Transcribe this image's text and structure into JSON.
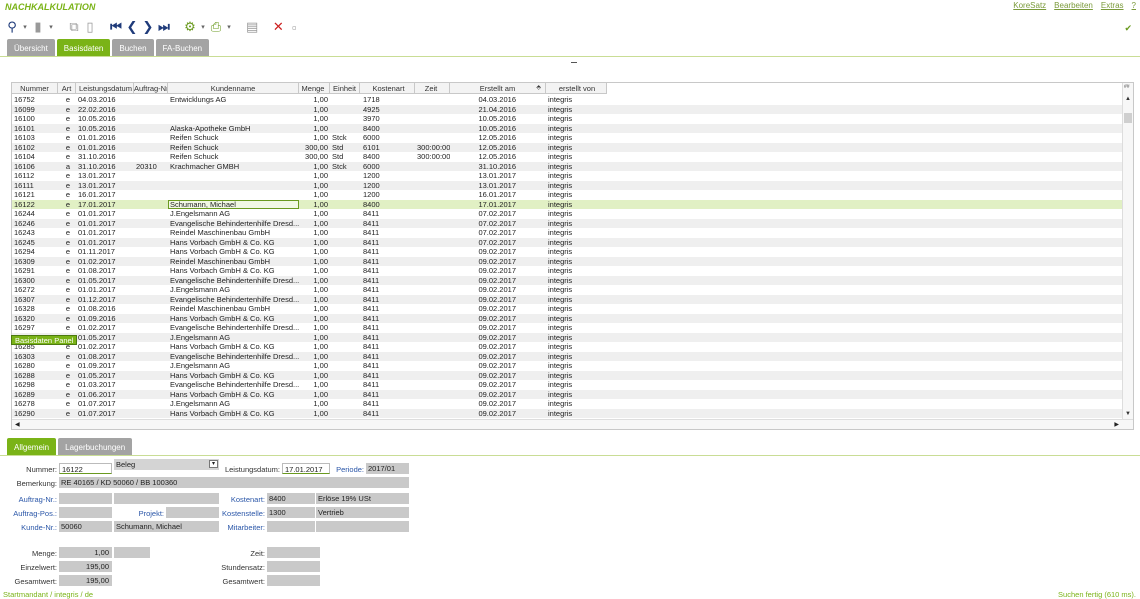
{
  "app": {
    "title": "NACHKALKULATION"
  },
  "top_menu": [
    "KoreSatz",
    "Bearbeiten",
    "Extras",
    "?"
  ],
  "toolbar": {
    "icons": [
      "search-icon",
      "document-icon",
      "copy-icon",
      "paste-icon",
      "first-record-icon",
      "previous-record-icon",
      "next-record-icon",
      "last-record-icon",
      "settings-icon",
      "print-icon",
      "save-icon",
      "delete-icon",
      "trash-icon"
    ]
  },
  "save_indicator": "✔",
  "main_tabs": [
    "Übersicht",
    "Basisdaten",
    "Buchen",
    "FA-Buchen"
  ],
  "active_main_tab": "Basisdaten",
  "grid": {
    "columns": [
      "Nummer",
      "Art",
      "Leistungsdatum",
      "Auftrag-Nr.",
      "Kundenname",
      "Menge",
      "Einheit",
      "Kostenart",
      "Zeit",
      "Erstellt am",
      "erstellt von"
    ],
    "sort_indicator": "⬘",
    "scroll_corner": "##",
    "rows": [
      [
        "16752",
        "e",
        "04.03.2016",
        "",
        "Entwicklungs AG",
        "1,00",
        "",
        "1718",
        "",
        "04.03.2016",
        "integris"
      ],
      [
        "16099",
        "e",
        "22.02.2016",
        "",
        "",
        "1,00",
        "",
        "4925",
        "",
        "21.04.2016",
        "integris"
      ],
      [
        "16100",
        "e",
        "10.05.2016",
        "",
        "",
        "1,00",
        "",
        "3970",
        "",
        "10.05.2016",
        "integris"
      ],
      [
        "16101",
        "e",
        "10.05.2016",
        "",
        "Alaska-Apotheke GmbH",
        "1,00",
        "",
        "8400",
        "",
        "10.05.2016",
        "integris"
      ],
      [
        "16103",
        "e",
        "01.01.2016",
        "",
        "Reifen Schuck",
        "1,00",
        "Stck",
        "6000",
        "",
        "12.05.2016",
        "integris"
      ],
      [
        "16102",
        "e",
        "01.01.2016",
        "",
        "Reifen Schuck",
        "300,00",
        "Std",
        "6101",
        "300:00:00",
        "12.05.2016",
        "integris"
      ],
      [
        "16104",
        "e",
        "31.10.2016",
        "",
        "Reifen Schuck",
        "300,00",
        "Std",
        "8400",
        "300:00:00",
        "12.05.2016",
        "integris"
      ],
      [
        "16106",
        "a",
        "31.10.2016",
        "20310",
        "Krachmacher GMBH",
        "1,00",
        "Stck",
        "6000",
        "",
        "31.10.2016",
        "integris"
      ],
      [
        "16112",
        "e",
        "13.01.2017",
        "",
        "",
        "1,00",
        "",
        "1200",
        "",
        "13.01.2017",
        "integris"
      ],
      [
        "16111",
        "e",
        "13.01.2017",
        "",
        "",
        "1,00",
        "",
        "1200",
        "",
        "13.01.2017",
        "integris"
      ],
      [
        "16121",
        "e",
        "16.01.2017",
        "",
        "",
        "1,00",
        "",
        "1200",
        "",
        "16.01.2017",
        "integris"
      ],
      [
        "16122",
        "e",
        "17.01.2017",
        "",
        "Schumann, Michael",
        "1,00",
        "",
        "8400",
        "",
        "17.01.2017",
        "integris"
      ],
      [
        "16244",
        "e",
        "01.01.2017",
        "",
        "J.Engelsmann AG",
        "1,00",
        "",
        "8411",
        "",
        "07.02.2017",
        "integris"
      ],
      [
        "16246",
        "e",
        "01.01.2017",
        "",
        "Evangelische Behindertenhilfe Dresd...",
        "1,00",
        "",
        "8411",
        "",
        "07.02.2017",
        "integris"
      ],
      [
        "16243",
        "e",
        "01.01.2017",
        "",
        "Reindel Maschinenbau GmbH",
        "1,00",
        "",
        "8411",
        "",
        "07.02.2017",
        "integris"
      ],
      [
        "16245",
        "e",
        "01.01.2017",
        "",
        "Hans Vorbach GmbH & Co. KG",
        "1,00",
        "",
        "8411",
        "",
        "07.02.2017",
        "integris"
      ],
      [
        "16294",
        "e",
        "01.11.2017",
        "",
        "Hans Vorbach GmbH & Co. KG",
        "1,00",
        "",
        "8411",
        "",
        "09.02.2017",
        "integris"
      ],
      [
        "16309",
        "e",
        "01.02.2017",
        "",
        "Reindel Maschinenbau GmbH",
        "1,00",
        "",
        "8411",
        "",
        "09.02.2017",
        "integris"
      ],
      [
        "16291",
        "e",
        "01.08.2017",
        "",
        "Hans Vorbach GmbH & Co. KG",
        "1,00",
        "",
        "8411",
        "",
        "09.02.2017",
        "integris"
      ],
      [
        "16300",
        "e",
        "01.05.2017",
        "",
        "Evangelische Behindertenhilfe Dresd...",
        "1,00",
        "",
        "8411",
        "",
        "09.02.2017",
        "integris"
      ],
      [
        "16272",
        "e",
        "01.01.2017",
        "",
        "J.Engelsmann AG",
        "1,00",
        "",
        "8411",
        "",
        "09.02.2017",
        "integris"
      ],
      [
        "16307",
        "e",
        "01.12.2017",
        "",
        "Evangelische Behindertenhilfe Dresd...",
        "1,00",
        "",
        "8411",
        "",
        "09.02.2017",
        "integris"
      ],
      [
        "16328",
        "e",
        "01.08.2016",
        "",
        "Reindel Maschinenbau GmbH",
        "1,00",
        "",
        "8411",
        "",
        "09.02.2017",
        "integris"
      ],
      [
        "16320",
        "e",
        "01.09.2016",
        "",
        "Hans Vorbach GmbH & Co. KG",
        "1,00",
        "",
        "8411",
        "",
        "09.02.2017",
        "integris"
      ],
      [
        "16297",
        "e",
        "01.02.2017",
        "",
        "Evangelische Behindertenhilfe Dresd...",
        "1,00",
        "",
        "8411",
        "",
        "09.02.2017",
        "integris"
      ],
      [
        "16274",
        "e",
        "01.05.2017",
        "",
        "J.Engelsmann AG",
        "1,00",
        "",
        "8411",
        "",
        "09.02.2017",
        "integris"
      ],
      [
        "16285",
        "e",
        "01.02.2017",
        "",
        "Hans Vorbach GmbH & Co. KG",
        "1,00",
        "",
        "8411",
        "",
        "09.02.2017",
        "integris"
      ],
      [
        "16303",
        "e",
        "01.08.2017",
        "",
        "Evangelische Behindertenhilfe Dresd...",
        "1,00",
        "",
        "8411",
        "",
        "09.02.2017",
        "integris"
      ],
      [
        "16280",
        "e",
        "01.09.2017",
        "",
        "J.Engelsmann AG",
        "1,00",
        "",
        "8411",
        "",
        "09.02.2017",
        "integris"
      ],
      [
        "16288",
        "e",
        "01.05.2017",
        "",
        "Hans Vorbach GmbH & Co. KG",
        "1,00",
        "",
        "8411",
        "",
        "09.02.2017",
        "integris"
      ],
      [
        "16298",
        "e",
        "01.03.2017",
        "",
        "Evangelische Behindertenhilfe Dresd...",
        "1,00",
        "",
        "8411",
        "",
        "09.02.2017",
        "integris"
      ],
      [
        "16289",
        "e",
        "01.06.2017",
        "",
        "Hans Vorbach GmbH & Co. KG",
        "1,00",
        "",
        "8411",
        "",
        "09.02.2017",
        "integris"
      ],
      [
        "16278",
        "e",
        "01.07.2017",
        "",
        "J.Engelsmann AG",
        "1,00",
        "",
        "8411",
        "",
        "09.02.2017",
        "integris"
      ],
      [
        "16290",
        "e",
        "01.07.2017",
        "",
        "Hans Vorbach GmbH & Co. KG",
        "1,00",
        "",
        "8411",
        "",
        "09.02.2017",
        "integris"
      ]
    ],
    "selected_row": 11
  },
  "panel_badge": "Basisdaten Panel",
  "sub_tabs": [
    "Allgemein",
    "Lagerbuchungen"
  ],
  "active_sub_tab": "Allgemein",
  "form": {
    "nummer_label": "Nummer:",
    "nummer_value": "16122",
    "beleg_value": "Beleg",
    "leistungsdatum_label": "Leistungsdatum:",
    "leistungsdatum_value": "17.01.2017",
    "periode_label": "Periode:",
    "periode_value": "2017/01",
    "bemerkung_label": "Bemerkung:",
    "bemerkung_value": "RE 40165 / KD 50060 / BB 100360",
    "auftrag_nr_label": "Auftrag-Nr.:",
    "auftrag_nr_value": "",
    "kostenart_label": "Kostenart:",
    "kostenart_value": "8400",
    "kostenart_desc": "Erlöse 19% USt",
    "auftrag_pos_label": "Auftrag-Pos.:",
    "auftrag_pos_value": "",
    "projekt_label": "Projekt:",
    "projekt_value": "",
    "kostenstelle_label": "Kostenstelle:",
    "kostenstelle_value": "1300",
    "kostenstelle_desc": "Vertrieb",
    "kunde_nr_label": "Kunde-Nr.:",
    "kunde_nr_value": "50060",
    "kunde_name": "Schumann, Michael",
    "mitarbeiter_label": "Mitarbeiter:",
    "mitarbeiter_value": "",
    "menge_label": "Menge:",
    "menge_value": "1,00",
    "zeit_label": "Zeit:",
    "zeit_value": "",
    "einzelwert_label": "Einzelwert:",
    "einzelwert_value": "195,00",
    "stundensatz_label": "Stundensatz:",
    "stundensatz_value": "",
    "gesamtwert_label": "Gesamtwert:",
    "gesamtwert_value": "195,00",
    "gesamtwert2_label": "Gesamtwert:",
    "gesamtwert2_value": ""
  },
  "status": {
    "left": "Startmandant / integris / de",
    "right": "Suchen fertig (610 ms)."
  },
  "colors": {
    "accent": "#7ab317",
    "selected_row": "#e1f0c4",
    "link": "#2a56a8",
    "field": "#c9c9c9"
  }
}
